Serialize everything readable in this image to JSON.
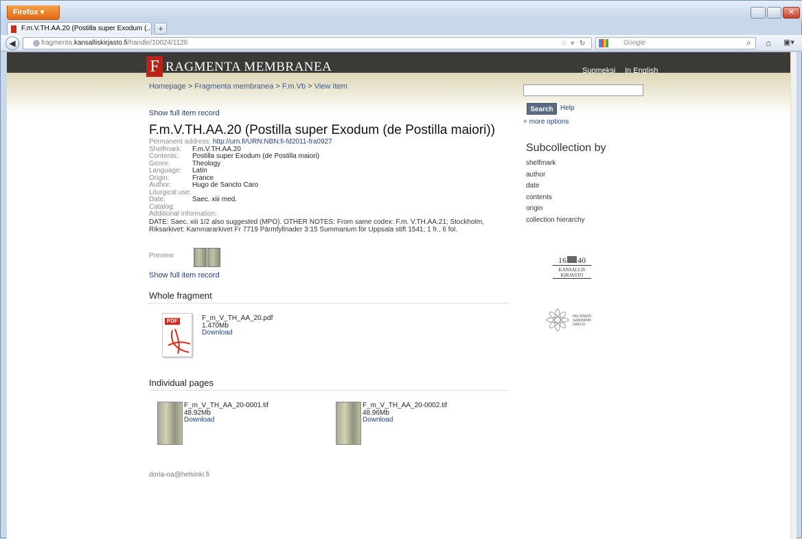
{
  "browser": {
    "menu_button": "Firefox ▾",
    "tab_title": "F.m.V.TH.AA.20 (Postilla super Exodum (...",
    "new_tab": "+",
    "url_host_prefix": "fragmenta.",
    "url_host_main": "kansalliskirjasto.fi",
    "url_path": "/handle/10024/1126",
    "search_placeholder": "Google"
  },
  "site": {
    "logo_letter": "F",
    "logo_text": "RAGMENTA MEMBRANEA",
    "lang_fi": "Suomeksi",
    "lang_en": "In English",
    "breadcrumb": [
      "Homepage",
      "Fragmenta membranea",
      "F.m.Vb",
      "View Item"
    ],
    "breadcrumb_sep": ">"
  },
  "item": {
    "show_full": "Show full item record",
    "title": "F.m.V.TH.AA.20 (Postilla super Exodum (de Postilla maiori))",
    "permanent_label": "Permanent address:",
    "permanent_link": "http://urn.fi/URN:NBN:fi-fd2011-fra0927",
    "fields": [
      {
        "k": "Shelfmark:",
        "v": "F.m.V.TH.AA.20"
      },
      {
        "k": "Contents:",
        "v": "Postilla super Exodum (de Postilla maiori)"
      },
      {
        "k": "Genre:",
        "v": "Theology"
      },
      {
        "k": "Language:",
        "v": "Latin"
      },
      {
        "k": "Origin:",
        "v": "France"
      },
      {
        "k": "Author:",
        "v": "Hugo de Sancto Caro"
      }
    ],
    "liturgical": "Liturgical use:",
    "date_label": "Date:",
    "date_value": "Saec. xiii med.",
    "catalog": "Catalog:",
    "additional_label": "Additional information:",
    "additional_text": "DATE: Saec. xiii 1/2 also suggested (MPO). OTHER NOTES: From same codex: F.m. V.TH.AA.21; Stockholm, Riksarkivet: Kammararkivet Fr 7719 Pärmfyllnader 3:15 Summarium för Uppsala stift 1541; 1 fr., 6 fol.",
    "preview_label": "Preview"
  },
  "whole": {
    "heading": "Whole fragment",
    "pdf_label": "PDF",
    "filename": "F_m_V_TH_AA_20.pdf",
    "size": "1.470Mb",
    "download": "Download"
  },
  "pages": {
    "heading": "Individual pages",
    "files": [
      {
        "name": "F_m_V_TH_AA_20-0001.tif",
        "size": "48.92Mb",
        "download": "Download"
      },
      {
        "name": "F_m_V_TH_AA_20-0002.tif",
        "size": "48.96Mb",
        "download": "Download"
      }
    ]
  },
  "footer_email": "doria-oa@helsinki.fi",
  "sidebar": {
    "search_button": "Search",
    "help": "Help",
    "more_options": "+ more options",
    "subcollection_heading": "Subcollection by",
    "subcollections": [
      "shelfmark",
      "author",
      "date",
      "contents",
      "origin",
      "collection hierarchy"
    ]
  },
  "logos": {
    "kk_year_left": "16",
    "kk_year_right": "40",
    "kk_line1": "KANSALLIS",
    "kk_line2": "KIRJASTO",
    "hs_line1": "HELSINGIN",
    "hs_line2": "SANOMAIN",
    "hs_line3": "SÄÄTIÖ"
  }
}
